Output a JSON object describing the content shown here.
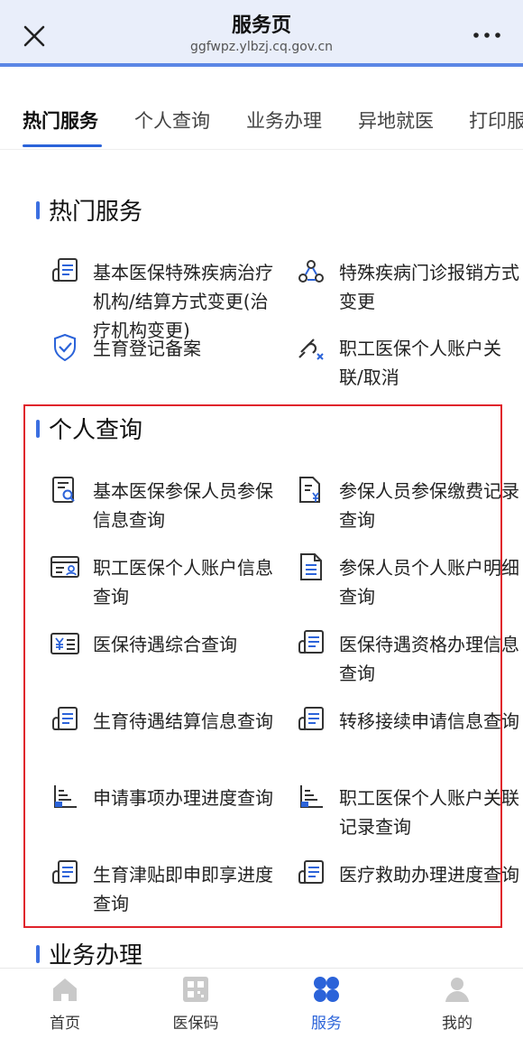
{
  "header": {
    "title": "服务页",
    "url": "ggfwpz.ylbzj.cq.gov.cn"
  },
  "tabs": [
    {
      "label": "热门服务",
      "active": true
    },
    {
      "label": "个人查询"
    },
    {
      "label": "业务办理"
    },
    {
      "label": "异地就医"
    },
    {
      "label": "打印服"
    }
  ],
  "sections": {
    "hot": {
      "title": "热门服务",
      "items": [
        {
          "label": "基本医保特殊疾病治疗机构/结算方式变更(治疗机构变更)",
          "icon": "form-icon"
        },
        {
          "label": "特殊疾病门诊报销方式变更",
          "icon": "people-network-icon"
        },
        {
          "label": "生育登记备案",
          "icon": "shield-check-icon"
        },
        {
          "label": "职工医保个人账户关联/取消",
          "icon": "unlink-icon"
        }
      ]
    },
    "personal": {
      "title": "个人查询",
      "items": [
        {
          "label": "基本医保参保人员参保信息查询",
          "icon": "search-doc-icon"
        },
        {
          "label": "参保人员参保缴费记录查询",
          "icon": "yuan-doc-icon"
        },
        {
          "label": "职工医保个人账户信息查询",
          "icon": "id-card-icon"
        },
        {
          "label": "参保人员个人账户明细查询",
          "icon": "document-icon"
        },
        {
          "label": "医保待遇综合查询",
          "icon": "yuan-card-icon"
        },
        {
          "label": "医保待遇资格办理信息查询",
          "icon": "form-icon"
        },
        {
          "label": "生育待遇结算信息查询",
          "icon": "form-icon"
        },
        {
          "label": "转移接续申请信息查询",
          "icon": "form-icon"
        },
        {
          "label": "申请事项办理进度查询",
          "icon": "progress-chart-icon"
        },
        {
          "label": "职工医保个人账户关联记录查询",
          "icon": "progress-chart-icon"
        },
        {
          "label": "生育津贴即申即享进度查询",
          "icon": "form-icon"
        },
        {
          "label": "医疗救助办理进度查询",
          "icon": "form-icon"
        }
      ]
    },
    "business": {
      "title": "业务办理"
    }
  },
  "bottom_nav": [
    {
      "label": "首页",
      "icon": "home-icon"
    },
    {
      "label": "医保码",
      "icon": "qr-code-icon"
    },
    {
      "label": "服务",
      "icon": "services-icon",
      "active": true
    },
    {
      "label": "我的",
      "icon": "profile-icon"
    }
  ],
  "colors": {
    "accent": "#2b63d9",
    "highlight_border": "#e0232b",
    "topbar_bg": "#e9eefa"
  }
}
